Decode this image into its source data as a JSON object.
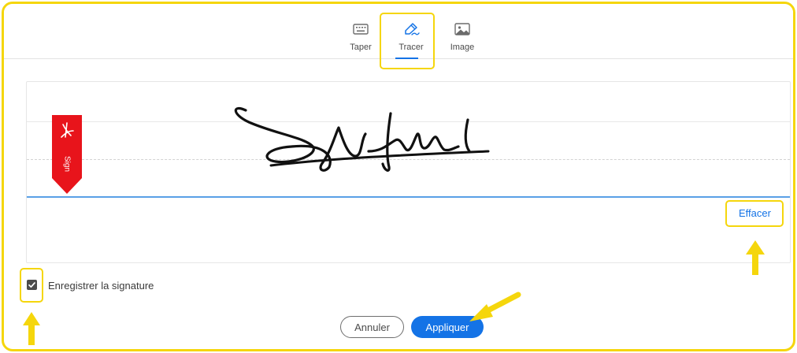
{
  "tabs": [
    {
      "label": "Taper",
      "icon": "keyboard-icon",
      "selected": false
    },
    {
      "label": "Tracer",
      "icon": "pen-draw-icon",
      "selected": true
    },
    {
      "label": "Image",
      "icon": "image-icon",
      "selected": false
    }
  ],
  "signature_pad": {
    "ribbon_label": "Sign",
    "clear_label": "Effacer"
  },
  "save_signature": {
    "label": "Enregistrer la signature",
    "checked": true
  },
  "actions": {
    "cancel_label": "Annuler",
    "apply_label": "Appliquer"
  },
  "colors": {
    "accent": "#1473e6",
    "highlight": "#f5d60c",
    "ribbon": "#e8141b"
  }
}
